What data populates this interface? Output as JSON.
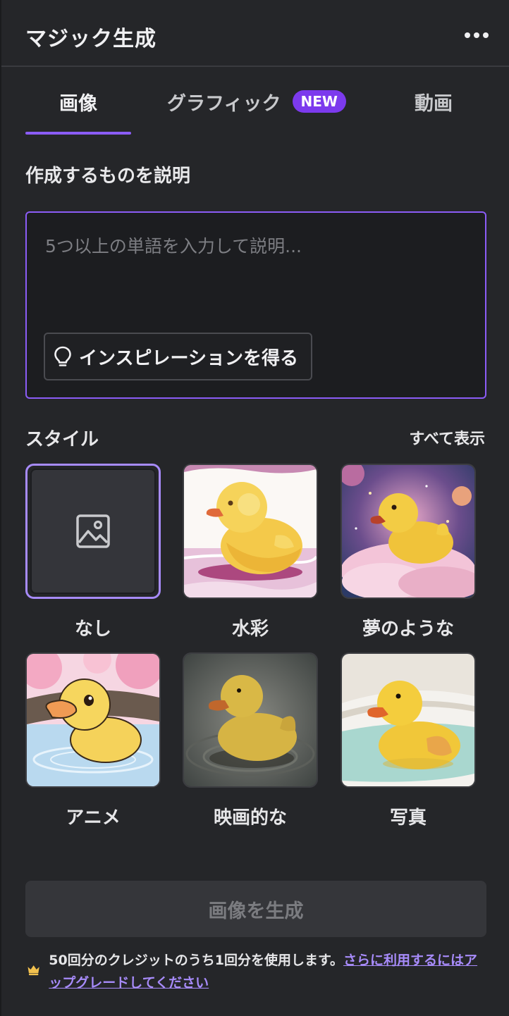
{
  "header": {
    "title": "マジック生成",
    "more_icon": "more-horizontal-icon"
  },
  "tabs": [
    {
      "label": "画像",
      "active": true
    },
    {
      "label": "グラフィック",
      "badge": "NEW",
      "active": false
    },
    {
      "label": "動画",
      "active": false
    }
  ],
  "prompt": {
    "section_label": "作成するものを説明",
    "value": "",
    "placeholder": "5つ以上の単語を入力して説明...",
    "inspiration_label": "インスピレーションを得る",
    "inspiration_icon": "lightbulb-icon"
  },
  "styles": {
    "section_label": "スタイル",
    "show_all_label": "すべて表示",
    "items": [
      {
        "name": "なし",
        "selected": true,
        "icon": "image-icon"
      },
      {
        "name": "水彩",
        "selected": false
      },
      {
        "name": "夢のような",
        "selected": false
      },
      {
        "name": "アニメ",
        "selected": false
      },
      {
        "name": "映画的な",
        "selected": false
      },
      {
        "name": "写真",
        "selected": false
      }
    ]
  },
  "generate": {
    "label": "画像を生成",
    "enabled": false
  },
  "credits": {
    "icon": "crown-icon",
    "text": "50回分のクレジットのうち1回分を使用します。",
    "link_text": "さらに利用するにはアップグレードしてください"
  },
  "colors": {
    "accent": "#8b5cf6",
    "badge": "#7c3aed",
    "background": "#252629",
    "crown": "#f2c14e"
  }
}
